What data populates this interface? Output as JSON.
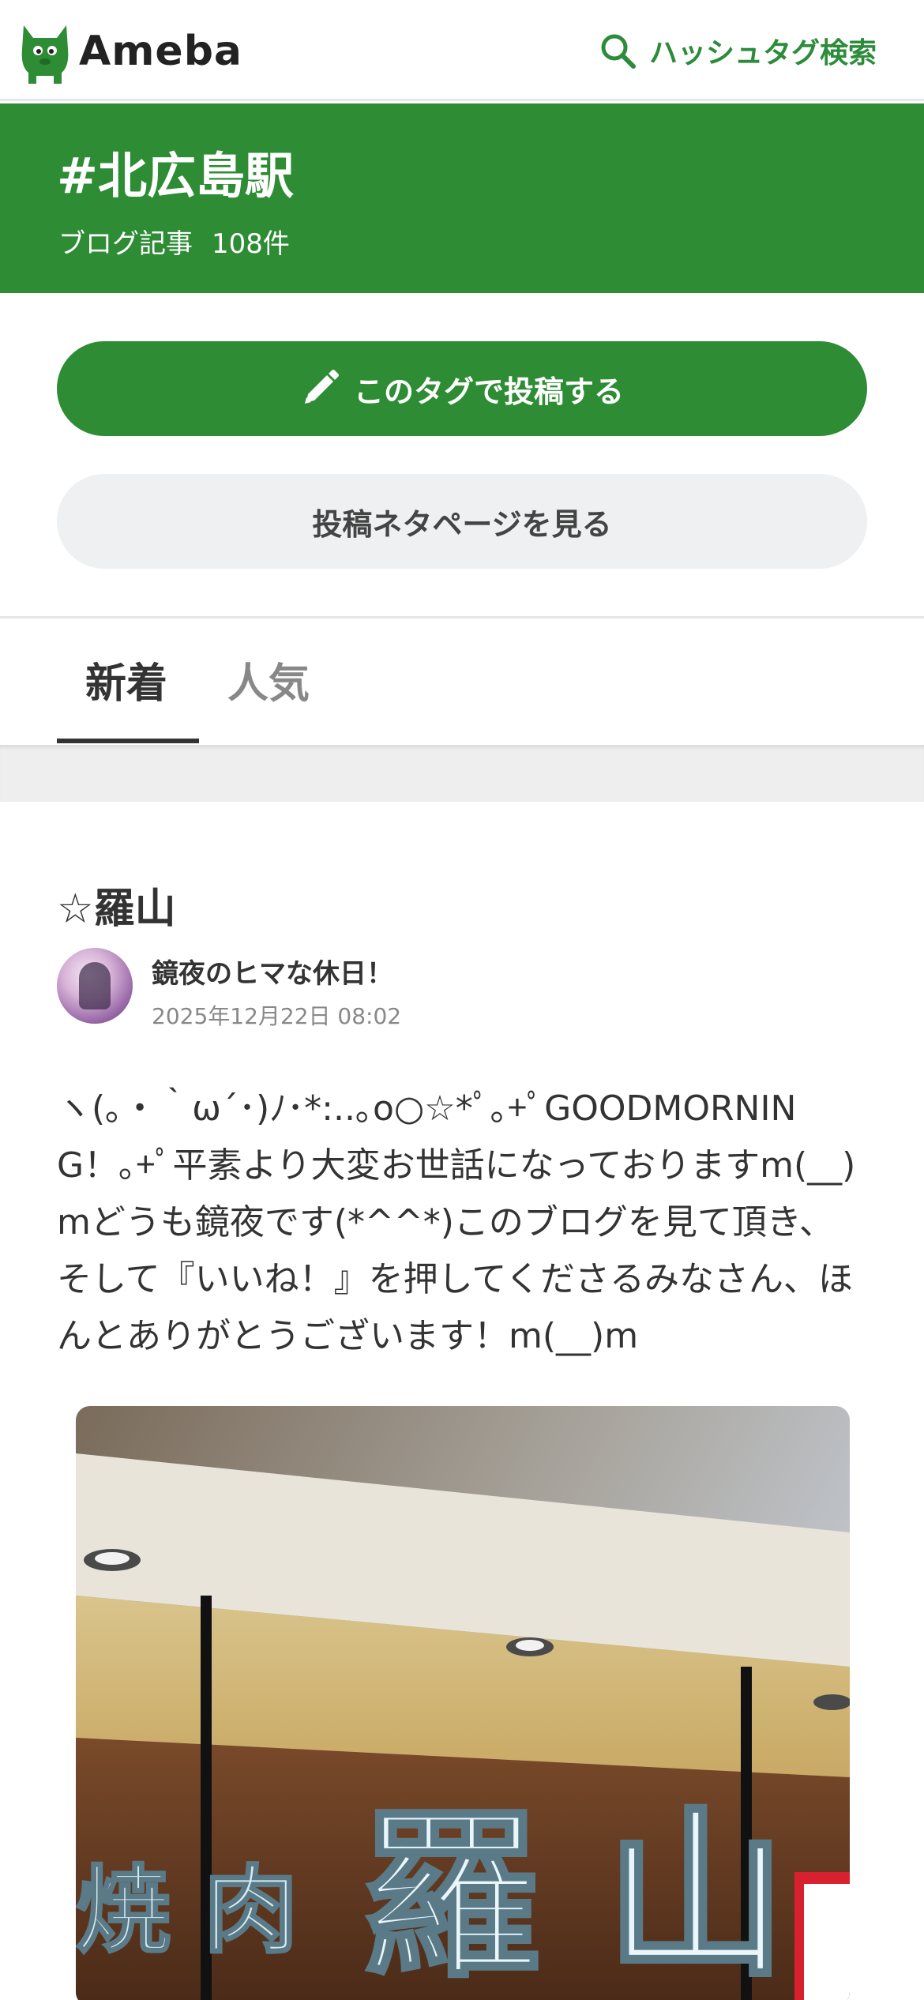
{
  "header": {
    "logo_text": "Ameba",
    "search_label": "ハッシュタグ検索"
  },
  "banner": {
    "hashtag": "#北広島駅",
    "count_label": "ブログ記事",
    "count_value": "108件"
  },
  "actions": {
    "post_label": "このタグで投稿する",
    "ideas_label": "投稿ネタページを見る"
  },
  "tabs": [
    {
      "label": "新着",
      "active": true
    },
    {
      "label": "人気",
      "active": false
    }
  ],
  "article": {
    "title": "☆羅山",
    "blog_name": "鏡夜のヒマな休日！",
    "date": "2025年12月22日 08:02",
    "excerpt": "ヽ(｡・｀ω´･)ﾉ･*:..｡o○☆*ﾟ｡+ﾟGOODMORNING！｡+ﾟ平素より大変お世話になっておりますm(__)mどうも鏡夜です(*^^*)このブログを見て頂き、そして『いいね！』を押してくださるみなさん、ほんとありがとうございます！m(__)m",
    "photo_sign_text": "焼肉羅山"
  },
  "colors": {
    "brand_green": "#2d8c34",
    "tab_inactive": "#888888",
    "secondary_button": "#eef0f1"
  },
  "icons": {
    "logo": "ameba-mascot-icon",
    "search": "search-icon",
    "post": "pencil-icon"
  }
}
